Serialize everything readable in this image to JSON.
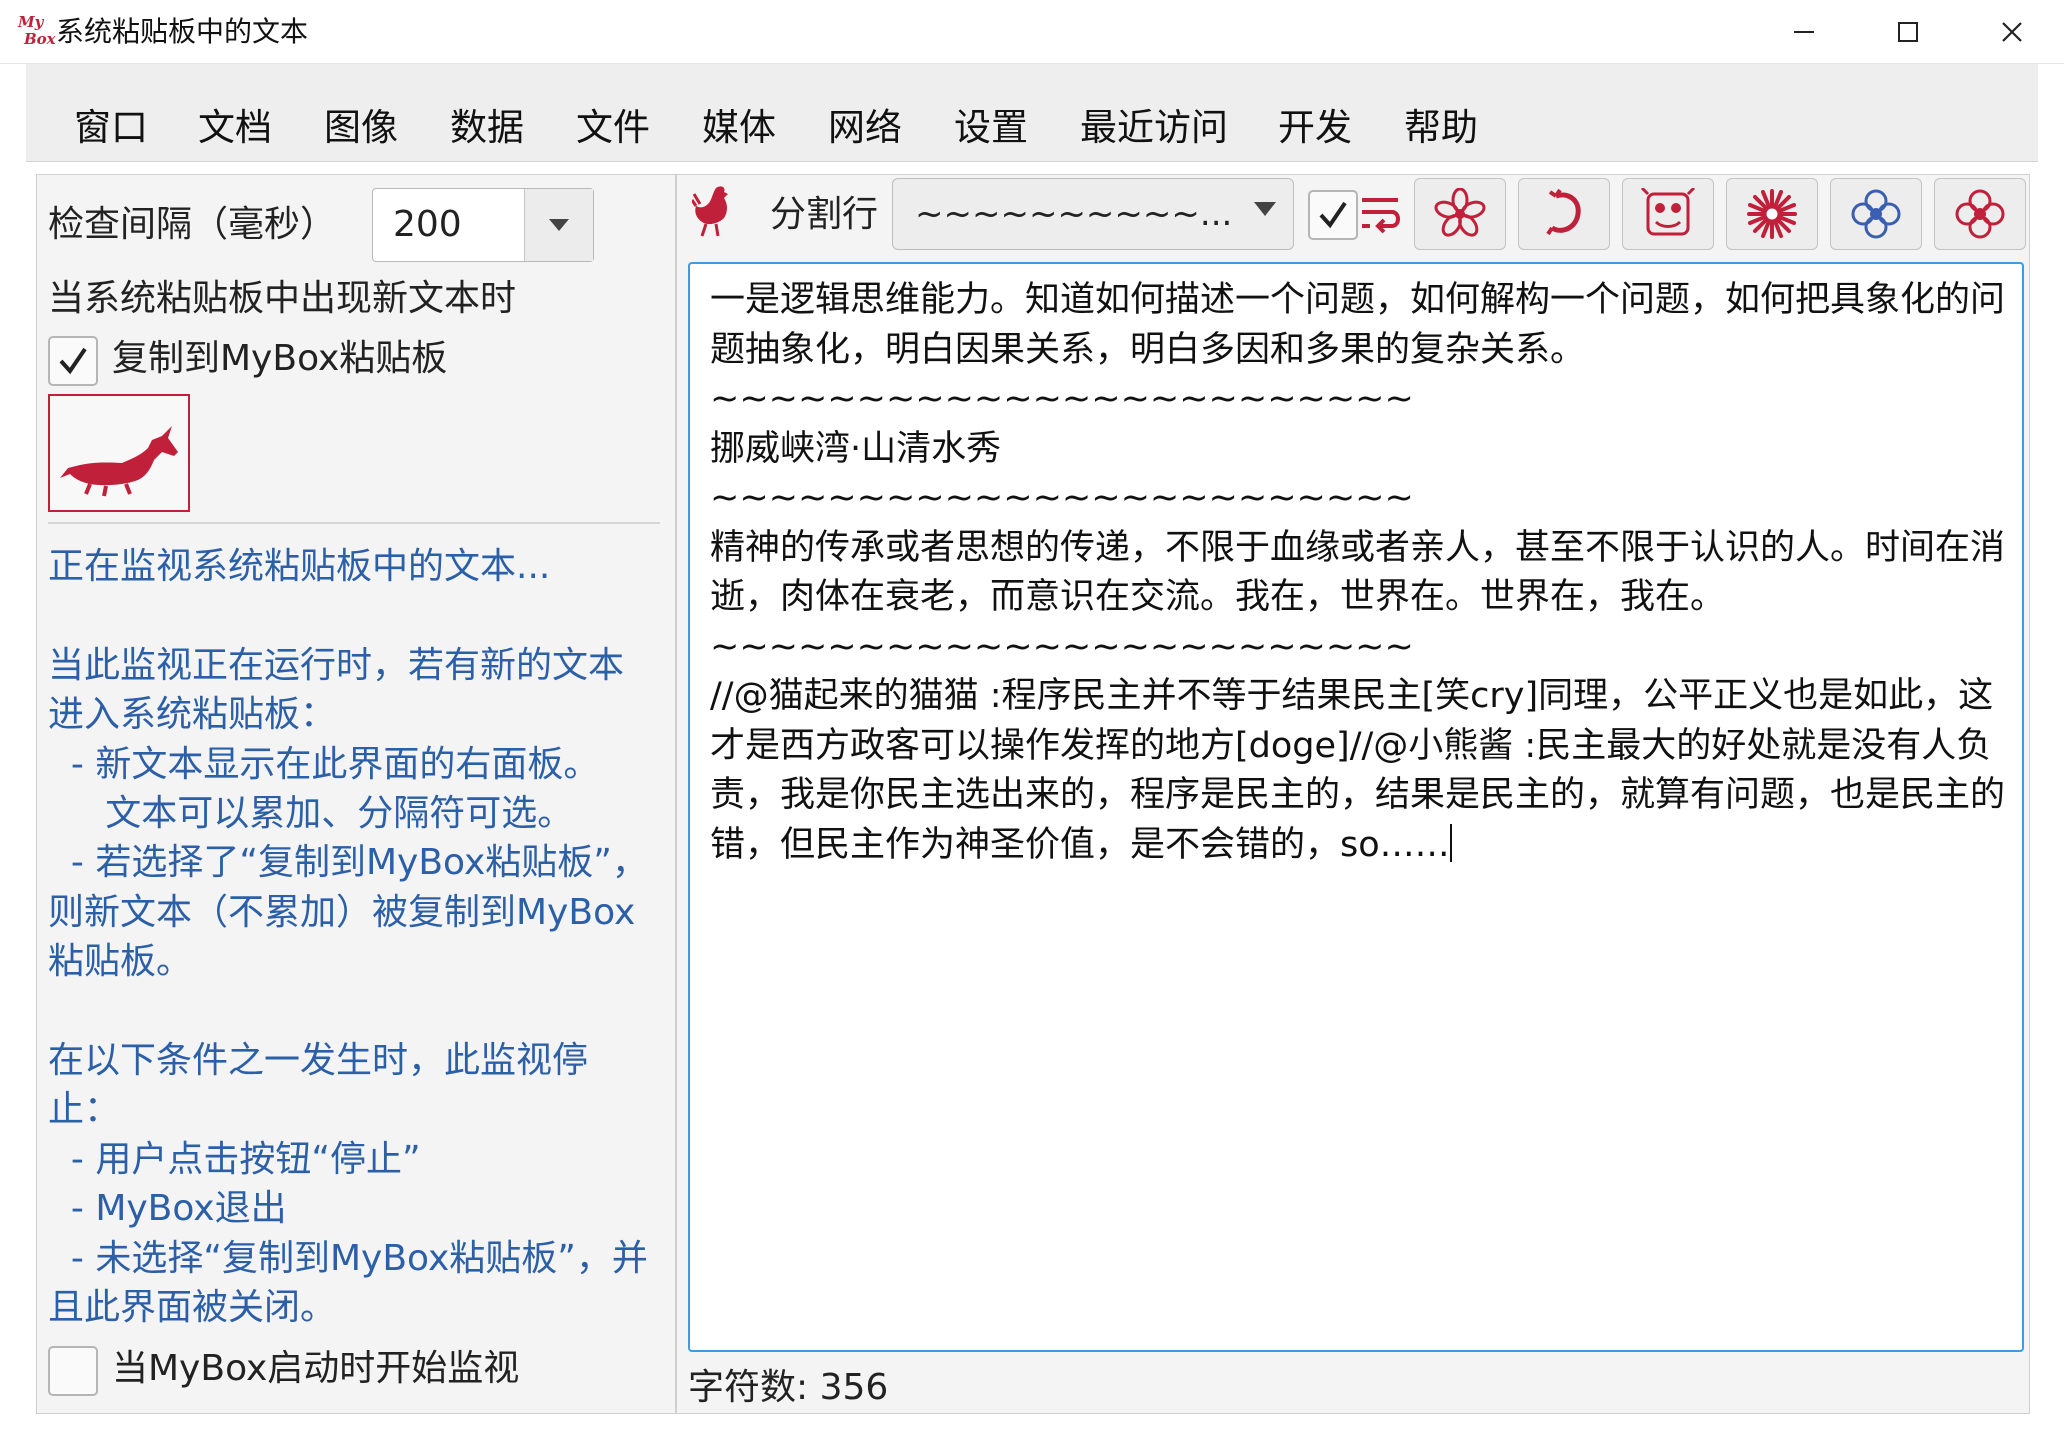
{
  "window": {
    "title": "系统粘贴板中的文本",
    "logo_top": "My",
    "logo_bottom": "Box"
  },
  "menu": [
    "窗口",
    "文档",
    "图像",
    "数据",
    "文件",
    "媒体",
    "网络",
    "设置",
    "最近访问",
    "开发",
    "帮助"
  ],
  "left": {
    "interval_label": "检查间隔（毫秒）",
    "interval_value": "200",
    "when_new_label": "当系统粘贴板中出现新文本时",
    "copy_label": "复制到MyBox粘贴板",
    "copy_checked": true,
    "description": "正在监视系统粘贴板中的文本...\n\n当此监视正在运行时，若有新的文本\n进入系统粘贴板：\n  - 新文本显示在此界面的右面板。\n     文本可以累加、分隔符可选。\n  - 若选择了“复制到MyBox粘贴板”，\n则新文本（不累加）被复制到MyBox\n粘贴板。\n\n在以下条件之一发生时，此监视停\n止：\n  - 用户点击按钮“停止”\n  - MyBox退出\n  - 未选择“复制到MyBox粘贴板”，并\n且此界面被关闭。",
    "start_label": "当MyBox启动时开始监视",
    "start_checked": false
  },
  "right": {
    "separator_label": "分割行",
    "separator_value": "~~~~~~~~~~...",
    "wrap_checked": true,
    "text": "一是逻辑思维能力。知道如何描述一个问题，如何解构一个问题，如何把具象化的问题抽象化，明白因果关系，明白多因和多果的复杂关系。\n~~~~~~~~~~~~~~~~~~~~~~~~\n挪威峡湾·山清水秀\n~~~~~~~~~~~~~~~~~~~~~~~~\n精神的传承或者思想的传递，不限于血缘或者亲人，甚至不限于认识的人。时间在消逝，肉体在衰老，而意识在交流。我在，世界在。世界在，我在。\n~~~~~~~~~~~~~~~~~~~~~~~~\n//@猫起来的猫猫 :程序民主并不等于结果民主[笑cry]同理，公平正义也是如此，这才是西方政客可以操作发挥的地方[doge]//@小熊酱 :民主最大的好处就是没有人负责，我是你民主选出来的，程序是民主的，结果是民主的，就算有问题，也是民主的错，但民主作为神圣价值，是不会错的，so……",
    "char_count": "字符数: 356"
  },
  "colors": {
    "accent": "#c0203a",
    "link_text": "#2b5fa7",
    "focus_border": "#3d9ae4",
    "flower_blue": "#3b5fb0"
  }
}
